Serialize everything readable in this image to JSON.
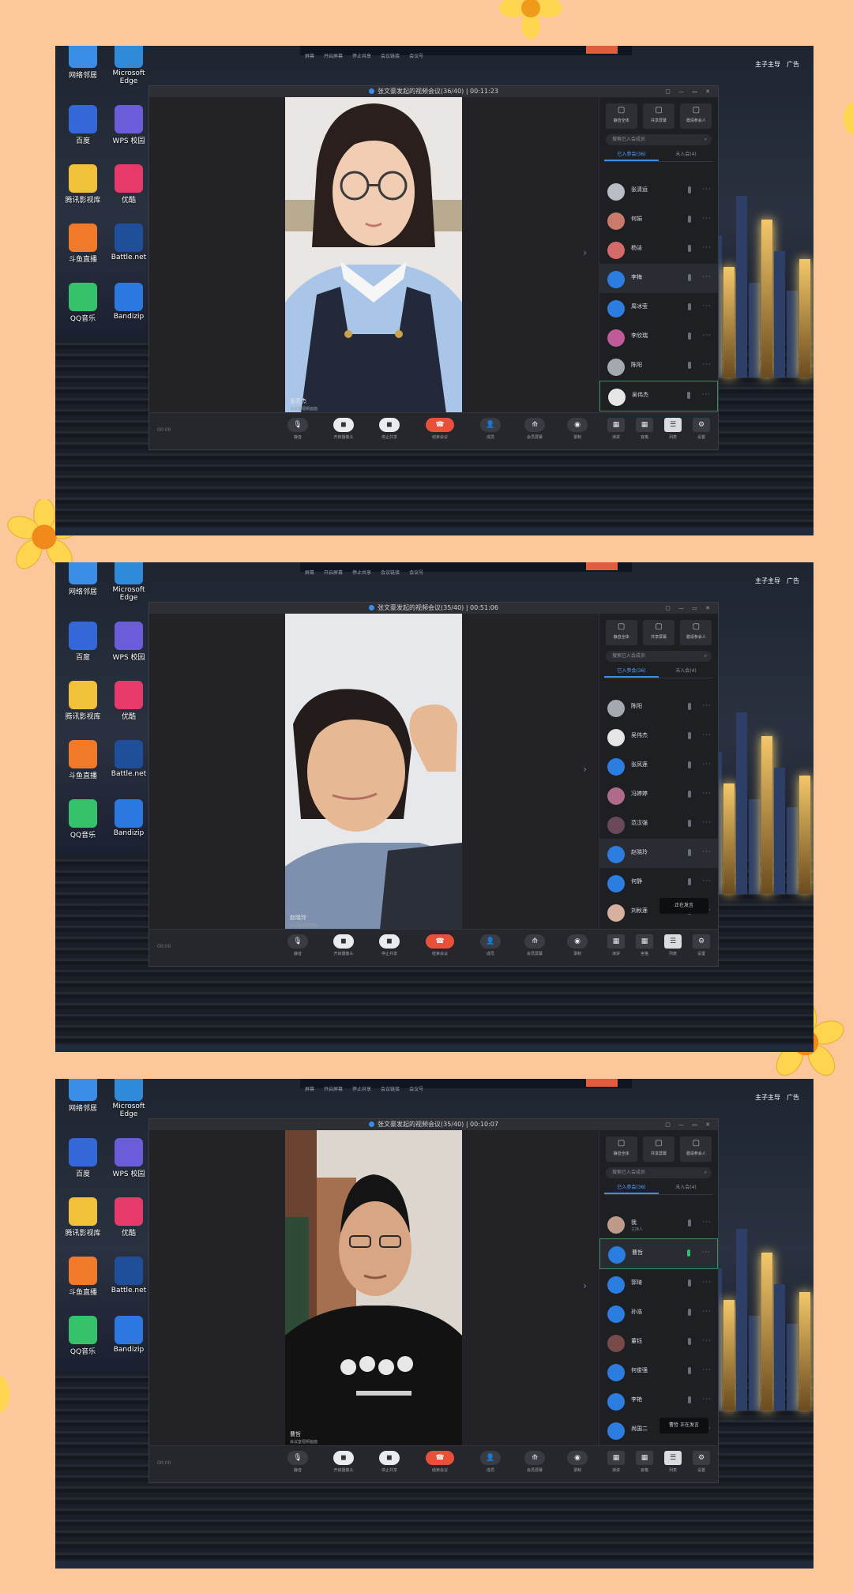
{
  "shots": [
    {
      "window_title": "张文豪发起的视频会议(36/40) | 00:11:23",
      "video": {
        "name": "张亮杰",
        "sub": "会议室视频画面",
        "person": "girl-glasses"
      },
      "participants": [
        {
          "name": "张清运",
          "sub": "",
          "color": "#b8bcc4",
          "mic_on": false,
          "selected": false
        },
        {
          "name": "何娟",
          "sub": "",
          "color": "#c97a6a",
          "mic_on": false,
          "selected": false
        },
        {
          "name": "杨洁",
          "sub": "",
          "color": "#d46a6a",
          "mic_on": false,
          "selected": false
        },
        {
          "name": "李梅",
          "sub": "",
          "color": "#2b7de0",
          "mic_on": false,
          "selected": true
        },
        {
          "name": "周冰莹",
          "sub": "",
          "color": "#2b7de0",
          "mic_on": false,
          "selected": false
        },
        {
          "name": "李欣瑞",
          "sub": "",
          "color": "#c05a9a",
          "mic_on": false,
          "selected": false
        },
        {
          "name": "陈阳",
          "sub": "",
          "color": "#a4a8b0",
          "mic_on": false,
          "selected": false
        },
        {
          "name": "吴伟杰",
          "sub": "",
          "color": "#e6e6e6",
          "mic_on": false,
          "selected": false,
          "bordered": true
        }
      ],
      "toast": ""
    },
    {
      "window_title": "张文豪发起的视频会议(35/40) | 00:51:06",
      "video": {
        "name": "赵晓玲",
        "sub": "会议室视频画面",
        "person": "girl-hand"
      },
      "participants": [
        {
          "name": "陈阳",
          "sub": "",
          "color": "#a4a8b0",
          "mic_on": false,
          "selected": false
        },
        {
          "name": "吴伟杰",
          "sub": "",
          "color": "#e6e6e6",
          "mic_on": false,
          "selected": false
        },
        {
          "name": "张凤莲",
          "sub": "",
          "color": "#2b7de0",
          "mic_on": false,
          "selected": false
        },
        {
          "name": "冯婷婷",
          "sub": "",
          "color": "#b06a8a",
          "mic_on": false,
          "selected": false
        },
        {
          "name": "范汉强",
          "sub": "",
          "color": "#6a4a5a",
          "mic_on": false,
          "selected": false
        },
        {
          "name": "赵晓玲",
          "sub": "",
          "color": "#2b7de0",
          "mic_on": false,
          "selected": true
        },
        {
          "name": "何静",
          "sub": "",
          "color": "#2b7de0",
          "mic_on": false,
          "selected": false
        },
        {
          "name": "刘秋莲",
          "sub": "",
          "color": "#d8b0a0",
          "mic_on": false,
          "selected": false
        }
      ],
      "toast": "正在发言"
    },
    {
      "window_title": "张文豪发起的视频会议(35/40) | 00:10:07",
      "video": {
        "name": "曹哲",
        "sub": "会议室视频画面",
        "person": "boy-glasses"
      },
      "participants": [
        {
          "name": "我",
          "sub": "主持人",
          "color": "#c09a88",
          "mic_on": false,
          "selected": false
        },
        {
          "name": "曹哲",
          "sub": "",
          "color": "#2b7de0",
          "mic_on": true,
          "selected": true,
          "bordered": true
        },
        {
          "name": "郭琦",
          "sub": "",
          "color": "#2b7de0",
          "mic_on": false,
          "selected": false
        },
        {
          "name": "孙浩",
          "sub": "",
          "color": "#2b7de0",
          "mic_on": false,
          "selected": false
        },
        {
          "name": "董钰",
          "sub": "",
          "color": "#7a4a4a",
          "mic_on": false,
          "selected": false
        },
        {
          "name": "何俊强",
          "sub": "",
          "color": "#2b7de0",
          "mic_on": false,
          "selected": false
        },
        {
          "name": "李艳",
          "sub": "",
          "color": "#2b7de0",
          "mic_on": false,
          "selected": false
        },
        {
          "name": "尚国二",
          "sub": "",
          "color": "#2b7de0",
          "mic_on": false,
          "selected": false
        }
      ],
      "toast": "曹哲 正在发言"
    }
  ],
  "topbar": [
    "屏幕",
    "开启屏幕",
    "停止共享",
    "会议链接",
    "会议号"
  ],
  "desktop_icons": [
    {
      "label": "网络邻居",
      "color": "#3b8ee8"
    },
    {
      "label": "Microsoft Edge",
      "color": "#2f8ad9"
    },
    {
      "label": "百度",
      "color": "#3468d9"
    },
    {
      "label": "WPS 校园",
      "color": "#6b5cd9"
    },
    {
      "label": "腾讯影视库",
      "color": "#f2c13a"
    },
    {
      "label": "优酷",
      "color": "#e53a6a"
    },
    {
      "label": "斗鱼直播",
      "color": "#f07a2a"
    },
    {
      "label": "Battle.net",
      "color": "#1f4f9a"
    },
    {
      "label": "QQ音乐",
      "color": "#35c26a"
    },
    {
      "label": "Bandizip",
      "color": "#2a78e0"
    }
  ],
  "right_desktop": [
    "主子主导",
    "广告"
  ],
  "panel": {
    "tools": [
      "静音全体",
      "共享屏幕",
      "邀请参会人"
    ],
    "search_placeholder": "搜索已入会成员",
    "tabs": [
      "已入参会(36)",
      "未入会(4)"
    ]
  },
  "controls": [
    "静音",
    "开启摄像头",
    "停止共享",
    "结束会议",
    "成员",
    "会员屏幕",
    "录制"
  ],
  "view_controls": [
    "演讲",
    "宫格",
    "列表",
    "设置"
  ],
  "lefttime": "00:00",
  "colors": {
    "bg": "#fcc79a",
    "accent": "#3b8ee8",
    "end": "#e9503a"
  }
}
